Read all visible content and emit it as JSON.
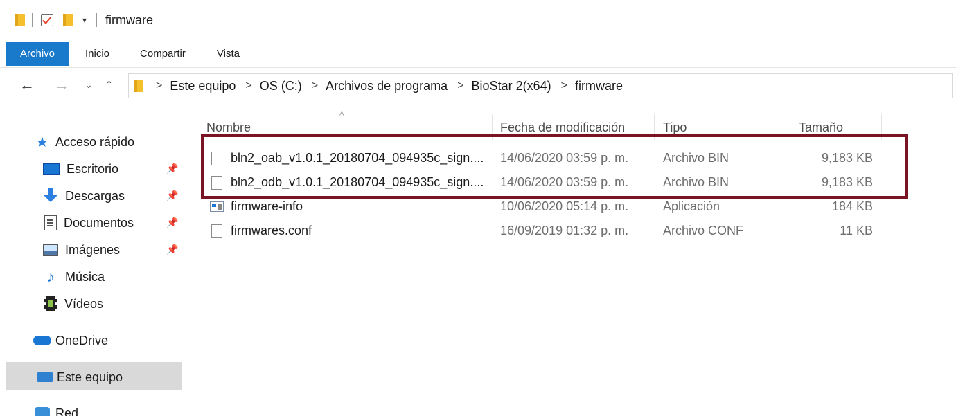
{
  "window": {
    "title": "firmware"
  },
  "ribbon": {
    "tabs": [
      "Archivo",
      "Inicio",
      "Compartir",
      "Vista"
    ]
  },
  "nav": {
    "back": "←",
    "forward": "→",
    "recent": "⌄",
    "up": "↑",
    "breadcrumb": [
      "Este equipo",
      "OS (C:)",
      "Archivos de programa",
      "BioStar 2(x64)",
      "firmware"
    ],
    "separator": ">"
  },
  "sidebar": {
    "items": [
      {
        "label": "Acceso rápido",
        "icon": "star-icon"
      },
      {
        "label": "Escritorio",
        "icon": "desktop-icon",
        "pinned": true
      },
      {
        "label": "Descargas",
        "icon": "download-icon",
        "pinned": true
      },
      {
        "label": "Documentos",
        "icon": "documents-icon",
        "pinned": true
      },
      {
        "label": "Imágenes",
        "icon": "pictures-icon",
        "pinned": true
      },
      {
        "label": "Música",
        "icon": "music-icon"
      },
      {
        "label": "Vídeos",
        "icon": "videos-icon"
      },
      {
        "label": "OneDrive",
        "icon": "cloud-icon"
      },
      {
        "label": "Este equipo",
        "icon": "this-pc-icon",
        "selected": true
      },
      {
        "label": "Red",
        "icon": "network-icon"
      }
    ],
    "pin_glyph": "📌"
  },
  "list": {
    "columns": [
      "Nombre",
      "Fecha de modificación",
      "Tipo",
      "Tamaño"
    ],
    "sort_indicator": "^",
    "rows": [
      {
        "name": "bln2_oab_v1.0.1_20180704_094935c_sign....",
        "date": "14/06/2020 03:59 p. m.",
        "type": "Archivo BIN",
        "size": "9,183 KB",
        "icon": "file-icon"
      },
      {
        "name": "bln2_odb_v1.0.1_20180704_094935c_sign....",
        "date": "14/06/2020 03:59 p. m.",
        "type": "Archivo BIN",
        "size": "9,183 KB",
        "icon": "file-icon"
      },
      {
        "name": "firmware-info",
        "date": "10/06/2020 05:14 p. m.",
        "type": "Aplicación",
        "size": "184 KB",
        "icon": "application-icon"
      },
      {
        "name": "firmwares.conf",
        "date": "16/09/2019 01:32 p. m.",
        "type": "Archivo CONF",
        "size": "11 KB",
        "icon": "file-icon"
      }
    ]
  },
  "annotation": {
    "color": "#7a1323"
  },
  "colors": {
    "accent": "#1979ca"
  }
}
